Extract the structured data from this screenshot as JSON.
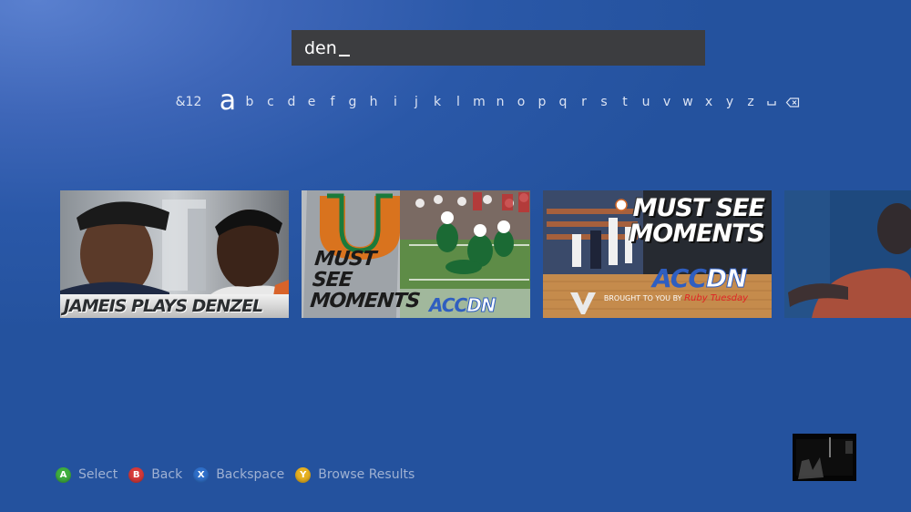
{
  "search": {
    "query": "den"
  },
  "keyboard": {
    "symbols_key": "&12",
    "selected_key": "a",
    "letters": [
      "b",
      "c",
      "d",
      "e",
      "f",
      "g",
      "h",
      "i",
      "j",
      "k",
      "l",
      "m",
      "n",
      "o",
      "p",
      "q",
      "r",
      "s",
      "t",
      "u",
      "v",
      "w",
      "x",
      "y",
      "z"
    ],
    "space_icon": "space-icon",
    "backspace_icon": "backspace-icon"
  },
  "results": [
    {
      "caption": "JAMEIS PLAYS DENZEL"
    },
    {
      "caption_lines": [
        "MUST",
        "SEE",
        "MOMENTS"
      ],
      "logo_main": "ACC",
      "logo_accent": "DN"
    },
    {
      "caption_lines": [
        "MUST SEE",
        "MOMENTS"
      ],
      "logo_main": "ACC",
      "logo_accent": "DN",
      "sponsor_prefix": "BROUGHT TO YOU BY",
      "sponsor_brand": "Ruby Tuesday"
    },
    {
      "caption": ""
    }
  ],
  "controller_hints": [
    {
      "button": "A",
      "label": "Select",
      "color": "#3fae3f"
    },
    {
      "button": "B",
      "label": "Back",
      "color": "#d63a3a"
    },
    {
      "button": "X",
      "label": "Backspace",
      "color": "#2f6fc9"
    },
    {
      "button": "Y",
      "label": "Browse Results",
      "color": "#e6b020"
    }
  ],
  "colors": {
    "background": "#2a58a8",
    "search_box": "#3c3d40",
    "hint_text": "#9fb1d2"
  }
}
